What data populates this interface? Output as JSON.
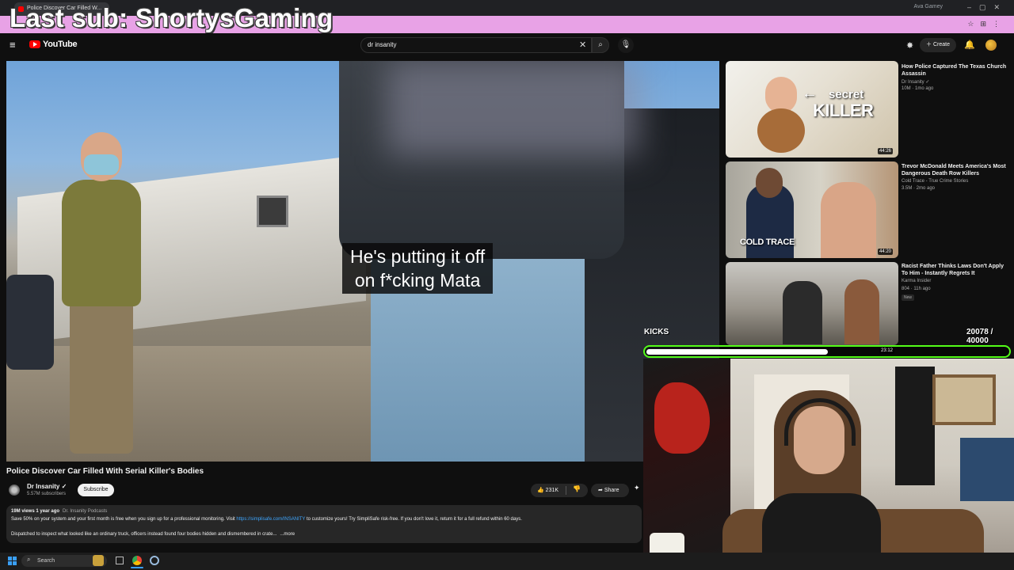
{
  "overlay": {
    "last_sub": "Last sub: ShortysGaming",
    "kicks_label": "KICKS",
    "kicks_count": "20078 / 40000",
    "kicks_progress": 0.502
  },
  "browser": {
    "tab_title": "Police Discover Car Filled W...",
    "profile": "Ava Gamey"
  },
  "header": {
    "brand": "YouTube",
    "search_value": "dr insanity",
    "create_label": "Create"
  },
  "video": {
    "caption_line1": "He's putting it off",
    "caption_line2": "on f*cking Mata",
    "title": "Police Discover Car Filled With Serial Killer's Bodies",
    "channel": "Dr Insanity",
    "subscribers": "5.57M subscribers",
    "subscribe_label": "Subscribe",
    "likes": "231K",
    "share_label": "Share",
    "desc_meta": "19M views  1 year ago",
    "desc_tag": "Dr. Insanity Podcasts",
    "desc_line1_a": "Save 50% on your system and your first month is free when you sign up for a professional monitoring. Visit ",
    "desc_link": "https://simplisafe.com/INSANITY",
    "desc_line1_b": " to customize yours! Try SimpliSafe risk-free. If you don't love it, return it for a full refund within 60 days.",
    "desc_line2": "Dispatched to inspect what looked like an ordinary truck, officers instead found four bodies hidden and dismembered in crate...",
    "more_label": "...more"
  },
  "recommendations": [
    {
      "title": "How Police Captured The Texas Church Assassin",
      "channel": "Dr Insanity",
      "stats": "10M · 1mo ago",
      "duration": "44:26",
      "thumb_text1": "secret",
      "thumb_text2": "KILLER"
    },
    {
      "title": "Trevor McDonald Meets America's Most Dangerous Death Row Killers",
      "channel": "Cold Trace - True Crime Stories",
      "stats": "3.5M · 2mo ago",
      "duration": "44:20",
      "thumb_text1": "COLD TRACE"
    },
    {
      "title": "Racist Father Thinks Laws Don't Apply To Him - Instantly Regrets It",
      "channel": "Karma Insider",
      "stats": "804 · 11h ago",
      "badge": "New",
      "duration": "23:12"
    }
  ],
  "taskbar": {
    "search_label": "Search"
  },
  "colors": {
    "kick_green": "#53fc18",
    "address_bar": "#e8a2e6",
    "yt_red": "#ff0000",
    "link_blue": "#3ea6ff"
  }
}
